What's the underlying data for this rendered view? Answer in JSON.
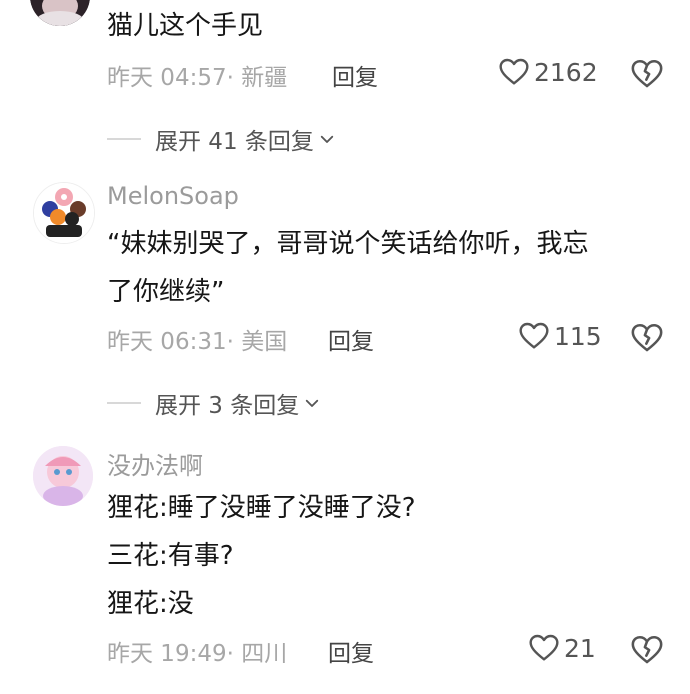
{
  "comments": [
    {
      "content": [
        "猫儿这个手见"
      ],
      "meta": "昨天 04:57· 新疆",
      "reply_label": "回复",
      "likes": "2162",
      "expand": "展开 41 条回复"
    },
    {
      "username": "MelonSoap",
      "content": [
        "“妹妹别哭了，哥哥说个笑话给你听，我忘",
        "了你继续”"
      ],
      "meta": "昨天 06:31· 美国",
      "reply_label": "回复",
      "likes": "115",
      "expand": "展开 3 条回复"
    },
    {
      "username": "没办法啊",
      "content": [
        "狸花:睡了没睡了没睡了没?",
        "三花:有事?",
        "狸花:没"
      ],
      "meta": "昨天 19:49· 四川",
      "reply_label": "回复",
      "likes": "21"
    }
  ],
  "icons": {
    "like": "heart-outline-icon",
    "dislike": "broken-heart-icon",
    "expand": "chevron-down-icon"
  }
}
